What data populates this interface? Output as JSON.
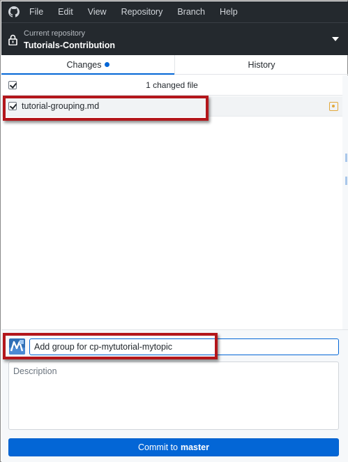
{
  "menu": {
    "items": [
      "File",
      "Edit",
      "View",
      "Repository",
      "Branch",
      "Help"
    ]
  },
  "repository": {
    "caption": "Current repository",
    "name": "Tutorials-Contribution"
  },
  "tabs": [
    {
      "label": "Changes",
      "active": true,
      "has_indicator": true
    },
    {
      "label": "History",
      "active": false
    }
  ],
  "changes": {
    "summary": "1 changed file",
    "all_checked": true,
    "files": [
      {
        "name": "tutorial-grouping.md",
        "checked": true,
        "status_icon": "modified-icon"
      }
    ]
  },
  "commit": {
    "summary_value": "Add group for cp-mytutorial-mytopic",
    "description_placeholder": "Description",
    "button_prefix": "Commit to",
    "branch": "master"
  },
  "colors": {
    "titlebar": "#24292e",
    "accent": "#0366d6",
    "modified": "#e2a83a",
    "annotation": "#b3161b"
  }
}
